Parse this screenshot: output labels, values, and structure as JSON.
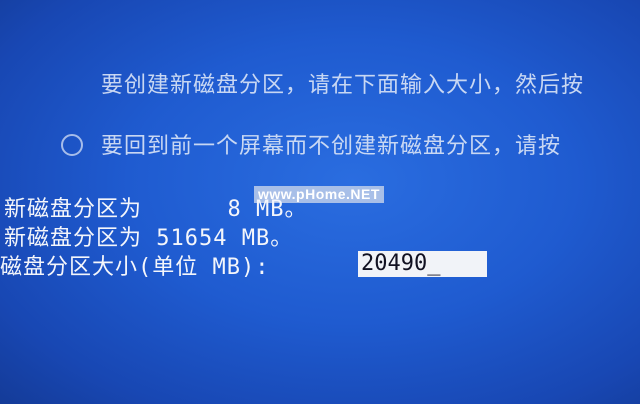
{
  "setup": {
    "line_create": "要创建新磁盘分区，请在下面输入大小，然后按",
    "line_back": "要回到前一个屏幕而不创建新磁盘分区，请按",
    "line_min": "新磁盘分区为      8 MB。",
    "line_max": "新磁盘分区为 51654 MB。",
    "size_prompt": "磁盘分区大小(单位 MB):",
    "size_input_value": "20490_",
    "watermark": "www.pHome.NET"
  },
  "colors": {
    "background": "#1f5bd0",
    "text": "#f4f6fb",
    "input_background": "#f1f3f8"
  }
}
